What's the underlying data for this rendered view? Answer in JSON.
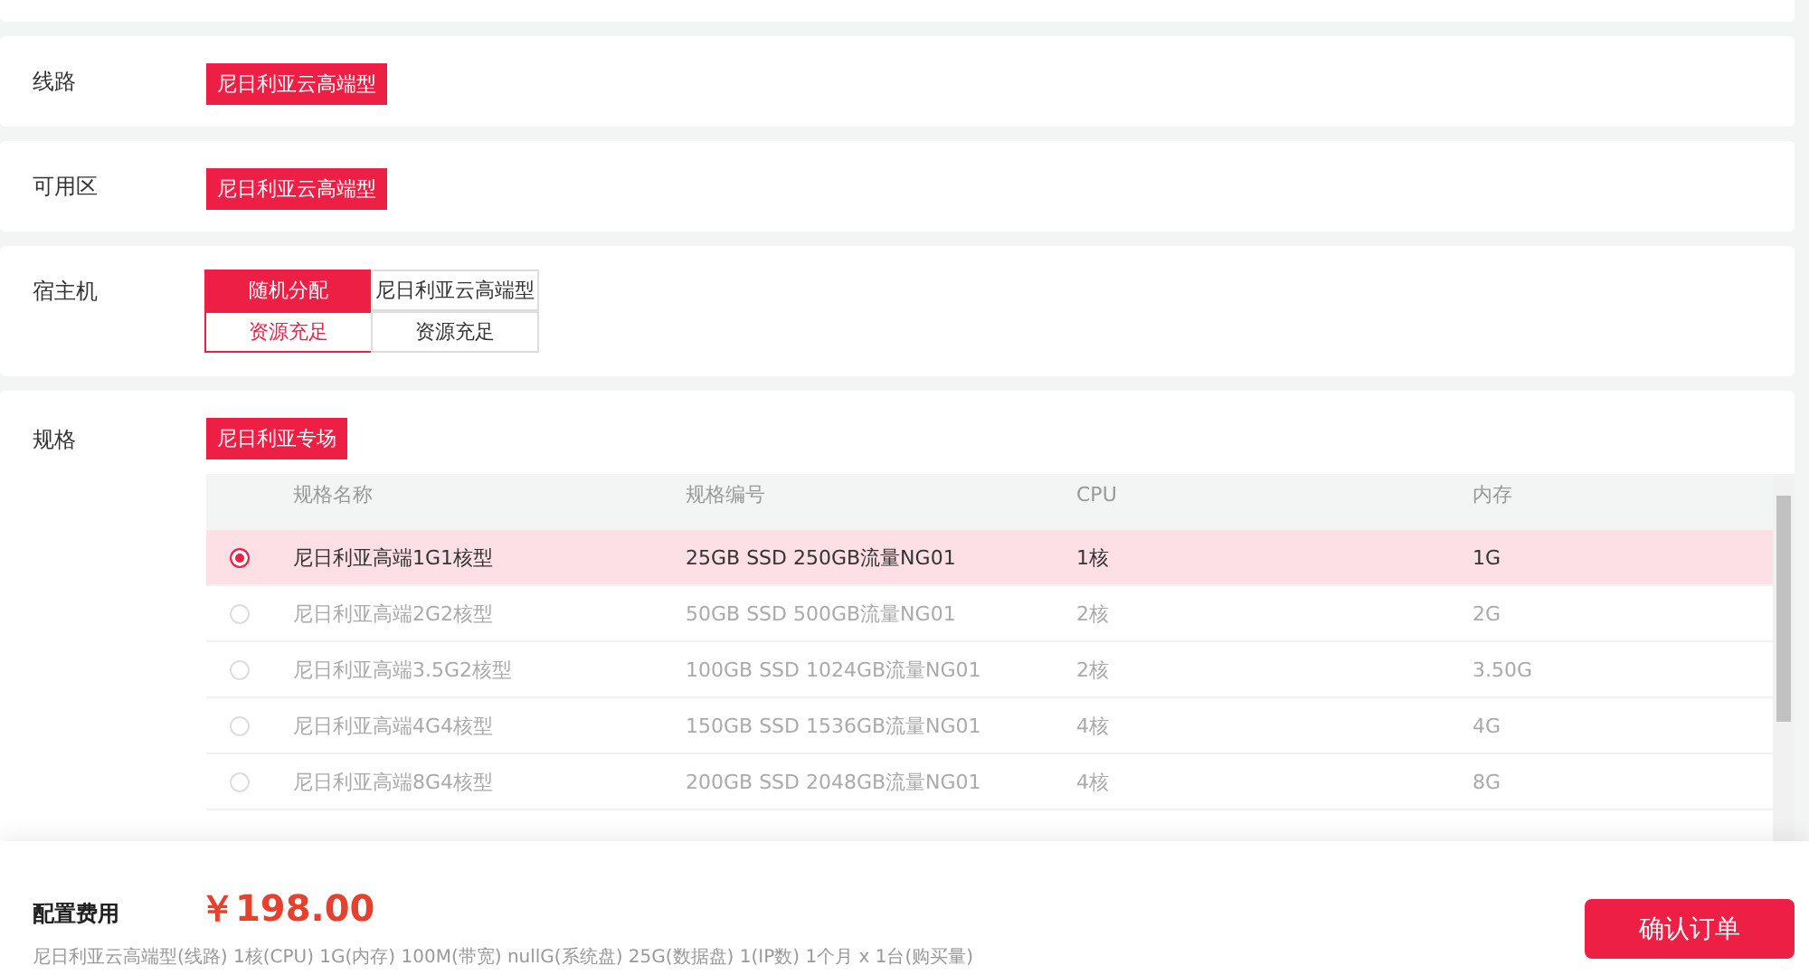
{
  "line": {
    "label": "线路",
    "options": [
      {
        "text": "尼日利亚云高端型",
        "selected": true
      }
    ]
  },
  "zone": {
    "label": "可用区",
    "options": [
      {
        "text": "尼日利亚云高端型",
        "selected": true
      }
    ]
  },
  "host": {
    "label": "宿主机",
    "options": [
      {
        "name": "随机分配",
        "status": "资源充足",
        "selected": true
      },
      {
        "name": "尼日利亚云高端型",
        "status": "资源充足",
        "selected": false
      }
    ]
  },
  "spec": {
    "label": "规格",
    "tabs": [
      {
        "text": "尼日利亚专场",
        "selected": true
      }
    ],
    "table": {
      "columns": [
        "规格名称",
        "规格编号",
        "CPU",
        "内存"
      ],
      "rows": [
        {
          "name": "尼日利亚高端1G1核型",
          "code": "25GB SSD 250GB流量NG01",
          "cpu": "1核",
          "memory": "1G",
          "selected": true
        },
        {
          "name": "尼日利亚高端2G2核型",
          "code": "50GB SSD 500GB流量NG01",
          "cpu": "2核",
          "memory": "2G",
          "selected": false
        },
        {
          "name": "尼日利亚高端3.5G2核型",
          "code": "100GB SSD 1024GB流量NG01",
          "cpu": "2核",
          "memory": "3.50G",
          "selected": false
        },
        {
          "name": "尼日利亚高端4G4核型",
          "code": "150GB SSD 1536GB流量NG01",
          "cpu": "4核",
          "memory": "4G",
          "selected": false
        },
        {
          "name": "尼日利亚高端8G4核型",
          "code": "200GB SSD 2048GB流量NG01",
          "cpu": "4核",
          "memory": "8G",
          "selected": false
        }
      ]
    }
  },
  "footer": {
    "label": "配置费用",
    "price": "￥198.00",
    "summary": "尼日利亚云高端型(线路) 1核(CPU) 1G(内存) 100M(带宽) nullG(系统盘) 25G(数据盘) 1(IP数) 1个月 x 1台(购买量)",
    "button": "确认订单"
  }
}
